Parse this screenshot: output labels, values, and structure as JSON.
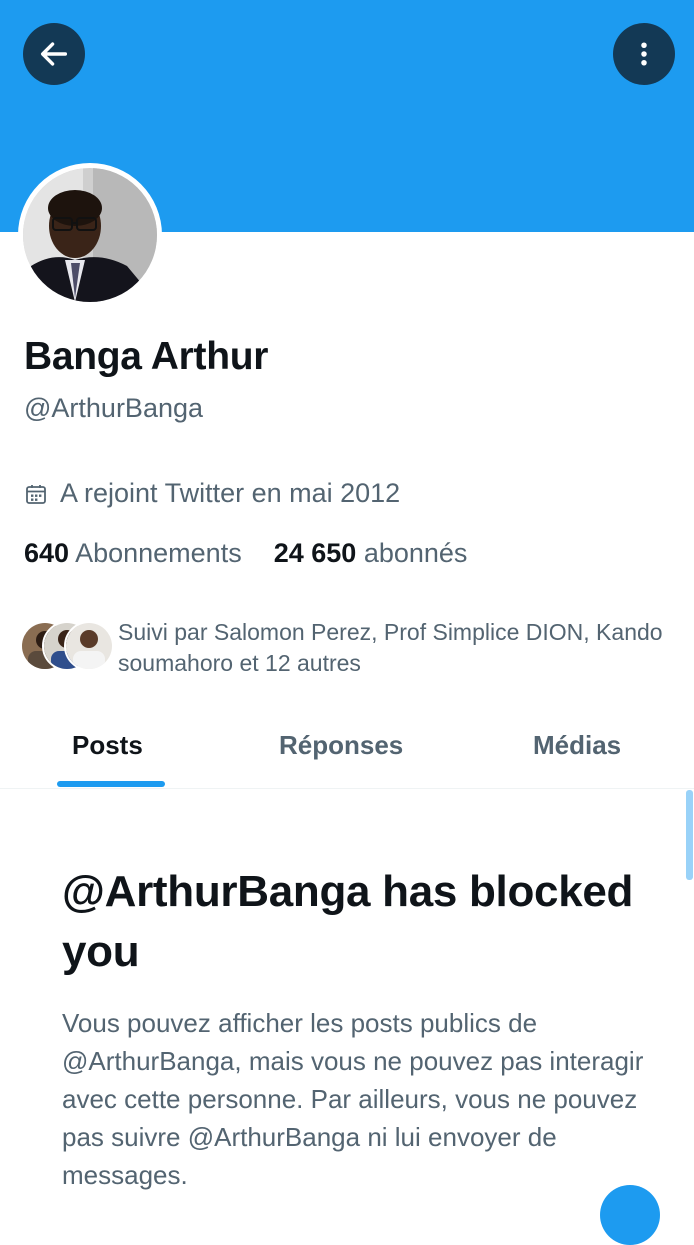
{
  "header": {
    "back_icon": "arrow-left-icon",
    "more_icon": "more-vertical-icon",
    "banner_color": "#1d9bf0"
  },
  "profile": {
    "name": "Banga Arthur",
    "handle": "@ArthurBanga",
    "joined": "A rejoint Twitter en mai 2012",
    "joined_icon": "calendar-icon",
    "following_count": "640",
    "following_label": "Abonnements",
    "followers_count": "24 650",
    "followers_label": "abonnés",
    "followed_by": "Suivi par Salomon Perez, Prof Simplice DION, Kando soumahoro et 12 autres"
  },
  "tabs": [
    {
      "label": "Posts",
      "active": true
    },
    {
      "label": "Réponses",
      "active": false
    },
    {
      "label": "Médias",
      "active": false
    }
  ],
  "blocked": {
    "title": "@ArthurBanga has blocked you",
    "body": "Vous pouvez afficher les posts publics de @ArthurBanga, mais vous ne pouvez pas interagir avec cette personne. Par ailleurs, vous ne pouvez pas suivre @ArthurBanga ni lui envoyer de messages."
  },
  "colors": {
    "accent": "#1d9bf0",
    "text_primary": "#0f1419",
    "text_secondary": "#536471"
  }
}
